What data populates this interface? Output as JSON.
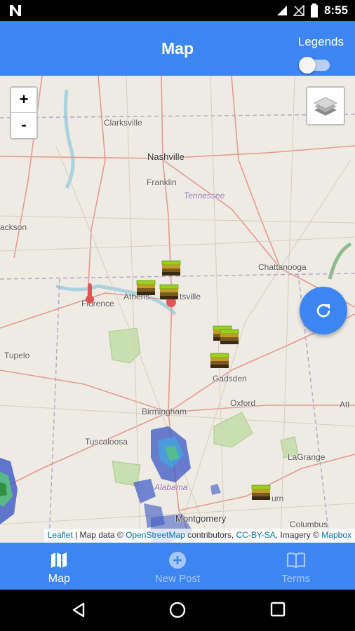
{
  "status_bar": {
    "time": "8:55",
    "icons": [
      "n-notification-icon",
      "signal-icon",
      "no-sim-icon",
      "battery-icon"
    ]
  },
  "app_bar": {
    "title": "Map",
    "legends_label": "Legends",
    "legends_toggle_on": false
  },
  "map": {
    "zoom_in": "+",
    "zoom_out": "-",
    "labels": {
      "clarksville": "Clarksville",
      "nashville": "Nashville",
      "franklin": "Franklin",
      "tennessee": "Tennessee",
      "jackson": "ackson",
      "chattanooga": "Chattanooga",
      "florence": "Florence",
      "athens": "Athens",
      "huntsville": "tsville",
      "tupelo": "Tupelo",
      "gadsden": "Gadsden",
      "oxford": "Oxford",
      "atlanta": "Atl",
      "birmingham": "Birmingham",
      "tuscaloosa": "Tuscaloosa",
      "lagrange": "LaGrange",
      "alabama": "Alabama",
      "auburn": "urn",
      "montgomery": "Montgomery",
      "columbus": "Columbus"
    },
    "attribution": {
      "leaflet": "Leaflet",
      "sep": " | Map data © ",
      "osm": "OpenStreetMap",
      "contrib": " contributors, ",
      "license": "CC-BY-SA",
      "imagery": ", Imagery © ",
      "mapbox": "Mapbox"
    },
    "marker_icons": [
      "soil-layers-marker-icon",
      "thermometer-marker-icon"
    ]
  },
  "bottom_nav": {
    "items": [
      {
        "label": "Map",
        "icon": "map-icon",
        "active": true
      },
      {
        "label": "New Post",
        "icon": "add-circle-icon",
        "active": false
      },
      {
        "label": "Terms",
        "icon": "book-icon",
        "active": false
      }
    ]
  },
  "colors": {
    "primary": "#3d86f2",
    "map_bg": "#eeebe4",
    "inactive_nav": "#a9c8f8"
  }
}
